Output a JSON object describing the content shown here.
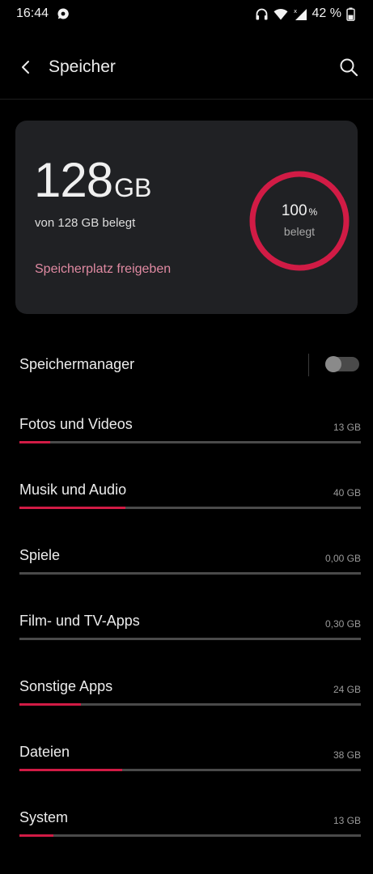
{
  "status_bar": {
    "time": "16:44",
    "battery_percent": "42 %",
    "icons": [
      "notification-icon",
      "headphones-icon",
      "wifi-icon",
      "cellular-signal-icon",
      "battery-icon"
    ]
  },
  "header": {
    "title": "Speicher",
    "back_icon": "back-arrow-icon",
    "search_icon": "search-icon"
  },
  "summary_card": {
    "used_value": "128",
    "used_unit": "GB",
    "used_of_total": "von 128 GB belegt",
    "free_up_link": "Speicherplatz freigeben",
    "ring_percent": "100",
    "ring_percent_unit": "%",
    "ring_label": "belegt",
    "ring_fraction": 1.0,
    "accent_color": "#d11b45",
    "link_color": "#e08aa2"
  },
  "storage_manager": {
    "label": "Speichermanager",
    "enabled": false
  },
  "categories": [
    {
      "label": "Fotos und Videos",
      "size": "13 GB",
      "fraction": 0.09
    },
    {
      "label": "Musik und Audio",
      "size": "40 GB",
      "fraction": 0.31
    },
    {
      "label": "Spiele",
      "size": "0,00 GB",
      "fraction": 0.0
    },
    {
      "label": "Film- und TV-Apps",
      "size": "0,30 GB",
      "fraction": 0.0
    },
    {
      "label": "Sonstige Apps",
      "size": "24 GB",
      "fraction": 0.18
    },
    {
      "label": "Dateien",
      "size": "38 GB",
      "fraction": 0.3
    },
    {
      "label": "System",
      "size": "13 GB",
      "fraction": 0.1
    }
  ]
}
